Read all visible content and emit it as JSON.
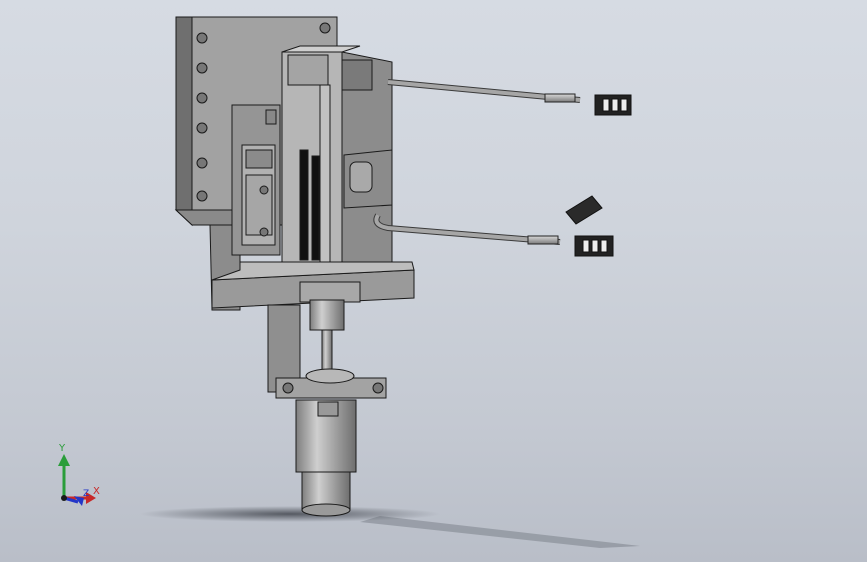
{
  "viewport": {
    "background_top": "#d6dbe3",
    "background_bottom": "#b9bec8"
  },
  "model": {
    "part_color": "#9c9c9c",
    "edge_color": "#1a1a1a",
    "cable_color": "#8e8e8e",
    "connector_color": "#222222"
  },
  "triad": {
    "y_label": "Y",
    "x_label": "X",
    "z_label": "Z",
    "x_color": "#c82828",
    "y_color": "#2a9d3a",
    "z_color": "#2436c8"
  }
}
